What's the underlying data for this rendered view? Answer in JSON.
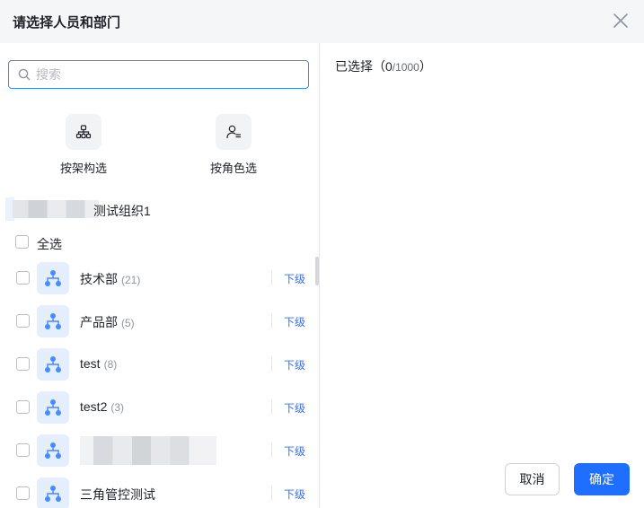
{
  "dialog": {
    "title": "请选择人员和部门"
  },
  "search": {
    "placeholder": "搜索",
    "value": ""
  },
  "modes": [
    {
      "label": "按架构选",
      "icon": "org-structure-icon"
    },
    {
      "label": "按角色选",
      "icon": "role-icon"
    }
  ],
  "breadcrumb": {
    "label": "测试组织1"
  },
  "select_all": {
    "label": "全选"
  },
  "departments": [
    {
      "name": "技术部",
      "count": "(21)",
      "sub_label": "下级"
    },
    {
      "name": "产品部",
      "count": "(5)",
      "sub_label": "下级"
    },
    {
      "name": "test",
      "count": "(8)",
      "sub_label": "下级"
    },
    {
      "name": "test2",
      "count": "(3)",
      "sub_label": "下级"
    },
    {
      "name": "",
      "count": "",
      "sub_label": "下级"
    },
    {
      "name": "三角管控测试",
      "count": "",
      "sub_label": "下级"
    }
  ],
  "selected": {
    "label": "已选择",
    "open": "（",
    "count": "0",
    "max": "/1000",
    "close": "）"
  },
  "footer": {
    "cancel_label": "取消",
    "ok_label": "确定"
  },
  "colors": {
    "accent": "#1e6fff",
    "link": "#3370ff",
    "header_bg": "#f5f6f7",
    "icon_bg": "#e5eefc",
    "icon_fg": "#4a8cf7"
  }
}
